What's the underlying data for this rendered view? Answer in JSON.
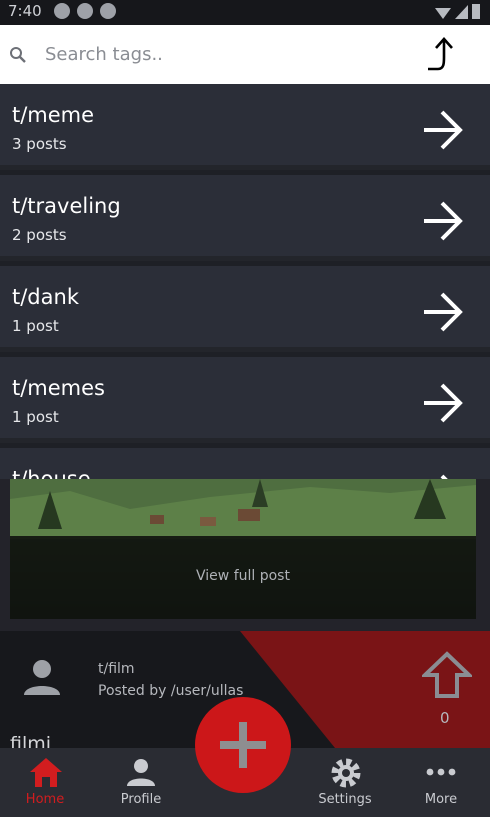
{
  "status_bar": {
    "time": "7:40"
  },
  "search": {
    "placeholder": "Search tags.."
  },
  "tags": [
    {
      "name": "t/meme",
      "count": "3 posts"
    },
    {
      "name": "t/traveling",
      "count": "2 posts"
    },
    {
      "name": "t/dank",
      "count": "1 post"
    },
    {
      "name": "t/memes",
      "count": "1 post"
    },
    {
      "name": "t/house",
      "count": ""
    }
  ],
  "feed": {
    "view_full_post": "View full post",
    "post": {
      "tag": "t/film",
      "posted_by": "Posted by /user/ullas",
      "votes": "0",
      "title": "filmi"
    }
  },
  "nav": {
    "home": "Home",
    "profile": "Profile",
    "settings": "Settings",
    "more": "More"
  },
  "colors": {
    "accent": "#cc1719",
    "list_bg": "#2b2e38",
    "nav_bg": "#2a2c33"
  }
}
